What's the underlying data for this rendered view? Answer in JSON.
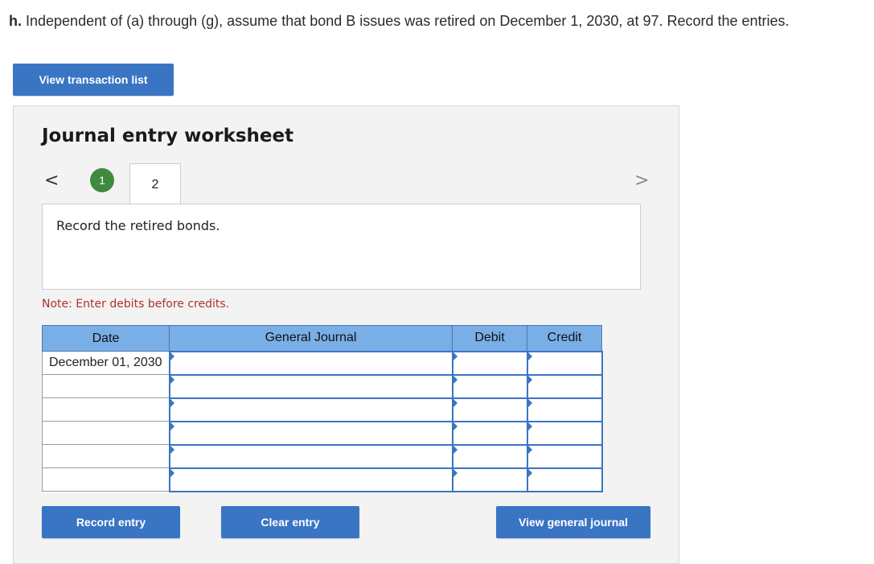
{
  "question": {
    "label": "h.",
    "text": " Independent of (a) through (g), assume that bond B issues was retired on December 1, 2030, at 97. Record the entries."
  },
  "buttons": {
    "view_transaction_list": "View transaction list",
    "record_entry": "Record entry",
    "clear_entry": "Clear entry",
    "view_general_journal": "View general journal"
  },
  "worksheet": {
    "title": "Journal entry worksheet",
    "nav_prev": "<",
    "nav_next": ">",
    "steps": [
      "1",
      "2"
    ],
    "current_step": "2",
    "description": "Record the retired bonds.",
    "note": "Note: Enter debits before credits."
  },
  "table": {
    "headers": [
      "Date",
      "General Journal",
      "Debit",
      "Credit"
    ],
    "rows": [
      {
        "date": "December 01, 2030",
        "account": "",
        "debit": "",
        "credit": ""
      },
      {
        "date": "",
        "account": "",
        "debit": "",
        "credit": ""
      },
      {
        "date": "",
        "account": "",
        "debit": "",
        "credit": ""
      },
      {
        "date": "",
        "account": "",
        "debit": "",
        "credit": ""
      },
      {
        "date": "",
        "account": "",
        "debit": "",
        "credit": ""
      },
      {
        "date": "",
        "account": "",
        "debit": "",
        "credit": ""
      }
    ]
  },
  "colors": {
    "button_blue": "#3a75c4",
    "header_blue": "#7aaee6",
    "step_done_green": "#3f8a3f",
    "note_red": "#b03030"
  }
}
